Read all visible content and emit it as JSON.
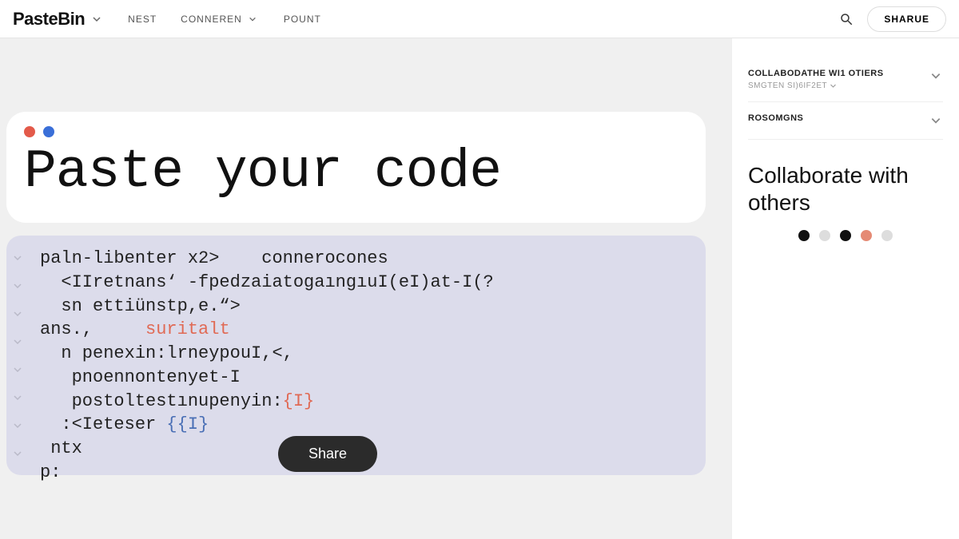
{
  "header": {
    "brand": "PasteBin",
    "nav": [
      {
        "label": "NEST",
        "has_dropdown": false
      },
      {
        "label": "CONNEREN",
        "has_dropdown": true
      },
      {
        "label": "POUNT",
        "has_dropdown": false
      }
    ],
    "share_label": "SHARUE"
  },
  "hero": {
    "title": "Paste your code"
  },
  "code": {
    "lines": [
      {
        "text": "paln-libenter x2>    connerocones"
      },
      {
        "text": "  <IIretnans‘ -fpedzaiatogaıngıuI(eI)at-I(?"
      },
      {
        "text": "  sn ettiünstp,e.“>"
      },
      {
        "text": "ans.,     ",
        "hl": "suritalt",
        "hl_class": "orange"
      },
      {
        "text": "  n penexin:lrneypouI,<,"
      },
      {
        "text": "   pnoennontenyet-I"
      },
      {
        "text": "   postoltestınupenyin:",
        "hl": "{I}",
        "hl_class": "orange"
      },
      {
        "text": "  :<Ieteser",
        "hl": " {{I}",
        "hl_class": "blue"
      },
      {
        "text": " ntx"
      },
      {
        "text": "p:"
      }
    ],
    "share_label": "Share"
  },
  "sidebar": {
    "sections": [
      {
        "heading": "COLLABODATHE WI1 OTIERS",
        "sub": "SMGTEN SI)6IF2ET"
      },
      {
        "heading": "ROSOMGNS"
      }
    ],
    "collab_title": "Collaborate with others",
    "indicators": [
      "k",
      "g",
      "k",
      "o",
      "g"
    ]
  }
}
